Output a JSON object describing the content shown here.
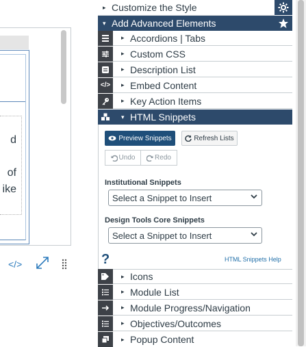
{
  "editor": {
    "text_lines": [
      "d",
      "",
      "of",
      "ike"
    ],
    "toolbar": {
      "html_label": "</>",
      "fullscreen_icon": "expand-icon",
      "drag_icon": "drag-handle-icon"
    }
  },
  "panel": {
    "top_items": [
      {
        "label": "Customize the Style",
        "caret": "▸"
      },
      {
        "label": "Add Advanced Elements",
        "caret": "▾"
      }
    ],
    "side_icons": {
      "gear": "gear-icon",
      "star": "star-icon"
    },
    "items": [
      {
        "label": "Accordions | Tabs",
        "icon": "accordion-icon",
        "glyph": "≣"
      },
      {
        "label": "Custom CSS",
        "icon": "sliders-icon",
        "glyph": "☰"
      },
      {
        "label": "Description List",
        "icon": "list-card-icon",
        "glyph": "▤"
      },
      {
        "label": "Embed Content",
        "icon": "code-icon",
        "glyph": "</>"
      },
      {
        "label": "Key Action Items",
        "icon": "key-icon",
        "glyph": "⚷"
      },
      {
        "label": "HTML Snippets",
        "icon": "cubes-icon",
        "glyph": "✿"
      }
    ],
    "snippets": {
      "preview_label": "Preview Snippets",
      "refresh_label": "Refresh Lists",
      "undo_label": "Undo",
      "redo_label": "Redo",
      "institutional_label": "Institutional Snippets",
      "institutional_value": "Select a Snippet to Insert",
      "core_label": "Design Tools Core Snippets",
      "core_value": "Select a Snippet to Insert",
      "help_symbol": "?",
      "help_link": "HTML Snippets Help"
    },
    "bottom_items": [
      {
        "label": "Icons",
        "icon": "tag-icon",
        "glyph": "⌂"
      },
      {
        "label": "Module List",
        "icon": "list-icon",
        "glyph": "☰"
      },
      {
        "label": "Module Progress/Navigation",
        "icon": "arrow-right-icon",
        "glyph": "→"
      },
      {
        "label": "Objectives/Outcomes",
        "icon": "list-icon",
        "glyph": "☰"
      },
      {
        "label": "Popup Content",
        "icon": "window-icon",
        "glyph": "❐"
      }
    ]
  },
  "colors": {
    "active_bg": "#2d4a6b",
    "icon_bg": "#3d4147",
    "accent": "#1f4f7a"
  }
}
